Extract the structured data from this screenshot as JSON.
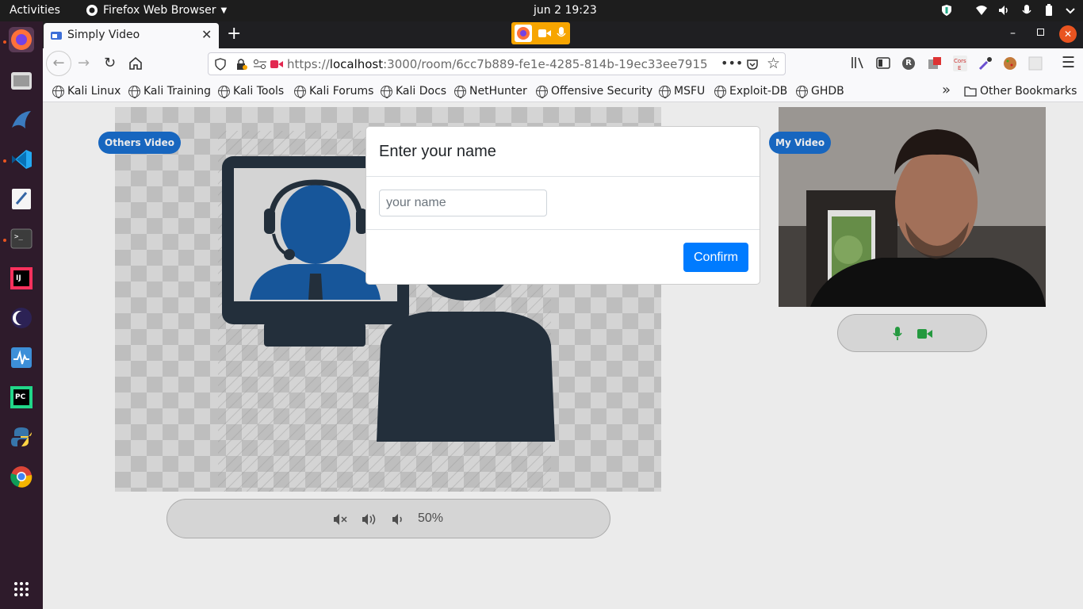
{
  "topbar": {
    "activities": "Activities",
    "app_menu": "Firefox Web Browser",
    "clock": "jun 2  19:23"
  },
  "dock": {
    "items": [
      "firefox-icon",
      "files-icon",
      "db-icon",
      "vscode-icon",
      "text-editor-icon",
      "terminal-icon",
      "intellij-icon",
      "eclipse-icon",
      "monitor-icon",
      "pycharm-icon",
      "python-icon",
      "chrome-icon",
      "app-grid-icon"
    ]
  },
  "browser": {
    "tab_title": "Simply Video",
    "new_tab": "+",
    "url": {
      "prefix": "https://",
      "host": "localhost",
      "rest": ":3000/room/6cc7b889-fe1e-4285-814b-19ec33ee7915"
    },
    "bookmarks": [
      "Kali Linux",
      "Kali Training",
      "Kali Tools",
      "Kali Forums",
      "Kali Docs",
      "NetHunter",
      "Offensive Security",
      "MSFU",
      "Exploit-DB",
      "GHDB"
    ],
    "other_bookmarks": "Other Bookmarks",
    "overflow": "»"
  },
  "page": {
    "others_label": "Others Video",
    "my_label": "My Video",
    "volume_value": "50%"
  },
  "modal": {
    "title": "Enter your name",
    "placeholder": "your name",
    "value": "",
    "confirm_label": "Confirm"
  },
  "colors": {
    "primary": "#007bff",
    "label_blue": "#1a6fd0",
    "mic_green": "#28a745",
    "dock_bg": "#2e1b2b"
  }
}
